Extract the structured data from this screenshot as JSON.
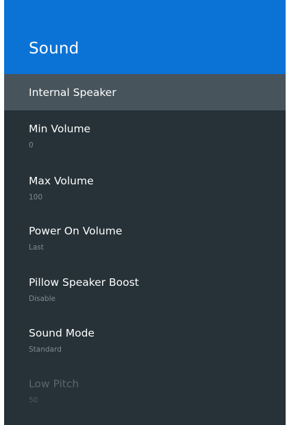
{
  "header": {
    "title": "Sound"
  },
  "items": [
    {
      "label": "Internal Speaker",
      "value": ""
    },
    {
      "label": "Min Volume",
      "value": "0"
    },
    {
      "label": "Max Volume",
      "value": "100"
    },
    {
      "label": "Power On Volume",
      "value": "Last"
    },
    {
      "label": "Pillow Speaker Boost",
      "value": "Disable"
    },
    {
      "label": "Sound Mode",
      "value": "Standard"
    },
    {
      "label": "Low Pitch",
      "value": "50"
    }
  ],
  "colors": {
    "header_bg": "#0b73d6",
    "panel_bg": "#263238",
    "selected_bg": "#47545c"
  }
}
